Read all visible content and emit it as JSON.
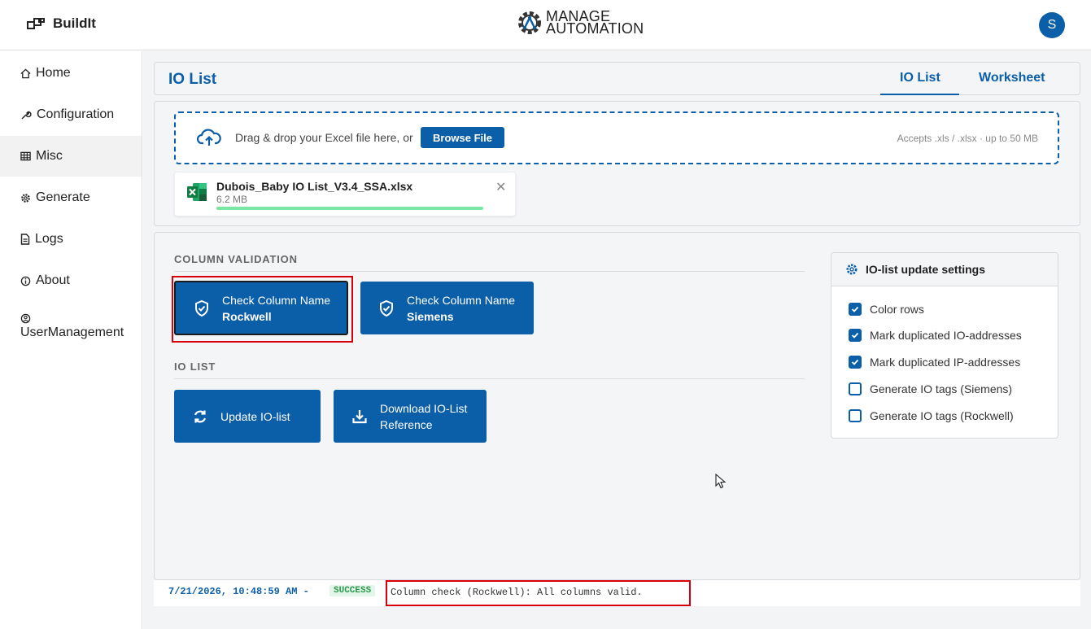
{
  "app": {
    "name": "BuildIt",
    "user_initial": "S"
  },
  "logo": {
    "line1": "MANAGE",
    "line2": "AUTOMATION"
  },
  "sidebar": {
    "items": [
      {
        "label": "Home",
        "icon": "home-icon"
      },
      {
        "label": "Configuration",
        "icon": "wrench-icon"
      },
      {
        "label": "Misc",
        "icon": "table-icon",
        "active": true
      },
      {
        "label": "Generate",
        "icon": "gear-icon"
      },
      {
        "label": "Logs",
        "icon": "document-icon"
      },
      {
        "label": "About",
        "icon": "info-icon"
      },
      {
        "label": "UserManagement",
        "icon": "user-circle-icon"
      }
    ]
  },
  "page": {
    "title": "IO List",
    "tabs": [
      {
        "label": "IO List",
        "active": true
      },
      {
        "label": "Worksheet",
        "active": false
      }
    ]
  },
  "upload": {
    "drop_text": "Drag & drop your Excel file here, or",
    "browse_label": "Browse File",
    "accepts": "Accepts .xls / .xlsx  ·  up to 50 MB",
    "file": {
      "name": "Dubois_Baby IO List_V3.4_SSA.xlsx",
      "size": "6.2 MB",
      "progress": 1.0
    }
  },
  "column_validation": {
    "label": "COLUMN VALIDATION",
    "buttons": [
      {
        "line1": "Check Column Name",
        "line2": "Rockwell",
        "selected": true
      },
      {
        "line1": "Check Column Name",
        "line2": "Siemens",
        "selected": false
      }
    ]
  },
  "io_list": {
    "label": "IO LIST",
    "buttons": [
      {
        "line1": "Update IO-list"
      },
      {
        "line1": "Download IO-List",
        "line2": "Reference"
      }
    ]
  },
  "settings": {
    "title": "IO-list update settings",
    "options": [
      {
        "label": "Color rows",
        "checked": true
      },
      {
        "label": "Mark duplicated IO-addresses",
        "checked": true
      },
      {
        "label": "Mark duplicated IP-addresses",
        "checked": true
      },
      {
        "label": "Generate IO tags (Siemens)",
        "checked": false
      },
      {
        "label": "Generate IO tags (Rockwell)",
        "checked": false
      }
    ]
  },
  "log": {
    "timestamp": "7/21/2026, 10:48:59 AM -",
    "status": "SUCCESS",
    "message": "Column check (Rockwell): All columns valid."
  },
  "colors": {
    "primary": "#0b5ea8",
    "success": "#2a9a4a",
    "highlight": "#d9000d"
  }
}
